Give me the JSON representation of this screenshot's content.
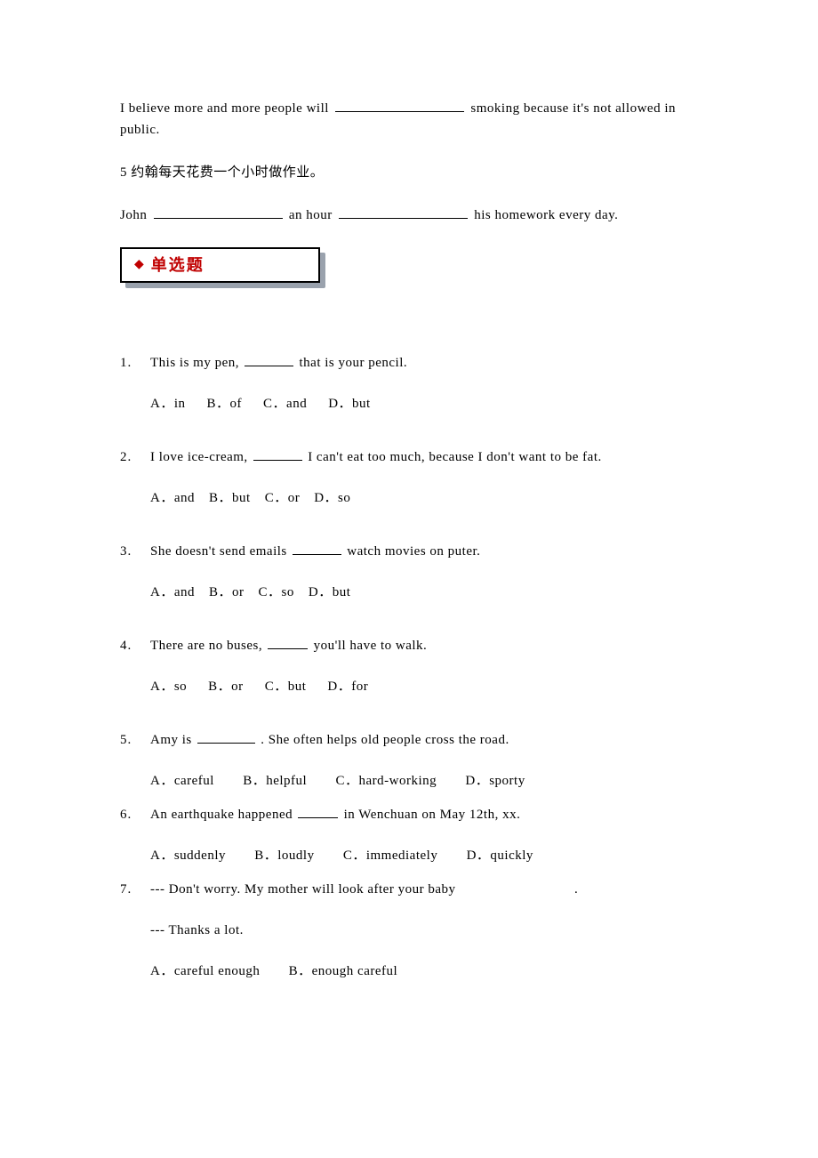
{
  "intro": {
    "p1_a": "I believe more and more people will ",
    "p1_b": " smoking because it's not allowed in public.",
    "p2": "5 约翰每天花费一个小时做作业。",
    "p3_a": "John ",
    "p3_b": " an hour ",
    "p3_c": " his homework every day."
  },
  "section": {
    "label": "单选题"
  },
  "questions": [
    {
      "num": "1.",
      "text_a": "This is my pen, ",
      "text_b": "that is your pencil.",
      "opts": [
        "A．in",
        "B．of",
        "C．and",
        "D．but"
      ]
    },
    {
      "num": "2.",
      "text_a": "I love ice-cream,",
      "text_b": " I can't eat too much, because I don't want to be fat.",
      "opts": [
        "A．and",
        "B．but",
        "C．or",
        "D．so"
      ]
    },
    {
      "num": "3.",
      "text_a": "She doesn't send emails ",
      "text_b": "watch movies on puter.",
      "opts": [
        "A．and",
        "B．or",
        "C．so",
        "D．but"
      ]
    },
    {
      "num": "4.",
      "text_a": "There are no buses,",
      "text_b": " you'll have to walk.",
      "opts": [
        "A．so",
        "B．or",
        "C．but",
        "D．for"
      ]
    },
    {
      "num": "5.",
      "text_a": "Amy is ",
      "text_b": ". She often helps old people cross the road.",
      "opts": [
        "A．careful",
        "B．helpful",
        "C．hard-working",
        "D．sporty"
      ]
    },
    {
      "num": "6.",
      "text_a": "An earthquake happened ",
      "text_b": "in Wenchuan on May 12th, xx.",
      "opts": [
        "A．suddenly",
        "B．loudly",
        "C．immediately",
        "D．quickly"
      ]
    },
    {
      "num": "7.",
      "lines": [
        "--- Don't worry. My mother will look after your baby",
        "--- Thanks a lot."
      ],
      "trail": ".",
      "opts": [
        "A．careful enough",
        "B．enough careful"
      ]
    }
  ]
}
